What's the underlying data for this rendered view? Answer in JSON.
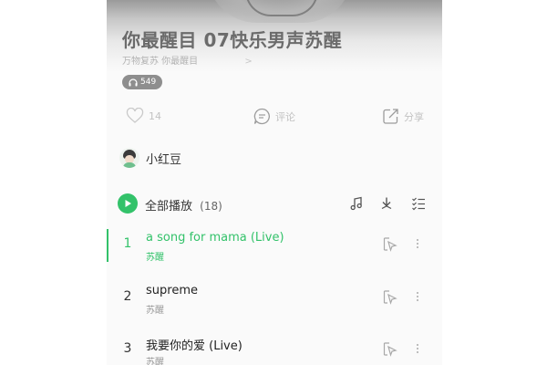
{
  "playlist": {
    "title": "你最醒目 07快乐男声苏醒",
    "subtitle": "万物复苏 你最醒目",
    "subtitle_arrow": ">",
    "listen_count": "549"
  },
  "actions": {
    "like_count": "14",
    "comment_label": "评论",
    "share_label": "分享"
  },
  "creator": {
    "name": "小红豆"
  },
  "play_all": {
    "label": "全部播放",
    "count": "(18)"
  },
  "tracks": [
    {
      "num": "1",
      "title": "a song for mama (Live)",
      "artist": "苏醒",
      "active": true
    },
    {
      "num": "2",
      "title": "supreme",
      "artist": "苏醒",
      "active": false
    },
    {
      "num": "3",
      "title": "我要你的爱 (Live)",
      "artist": "苏醒",
      "active": false
    }
  ],
  "colors": {
    "accent": "#33c26a",
    "pill": "#8e8e8e",
    "muted": "#c2c2c2"
  },
  "icons": {
    "listen": "headphones-icon",
    "like": "heart-icon",
    "comment": "comment-icon",
    "share": "share-icon",
    "play_all": "play-icon",
    "music_note": "music-note-icon",
    "download": "download-icon",
    "multi_select": "multi-select-icon",
    "track_play": "play-next-icon",
    "more": "more-vertical-icon"
  }
}
